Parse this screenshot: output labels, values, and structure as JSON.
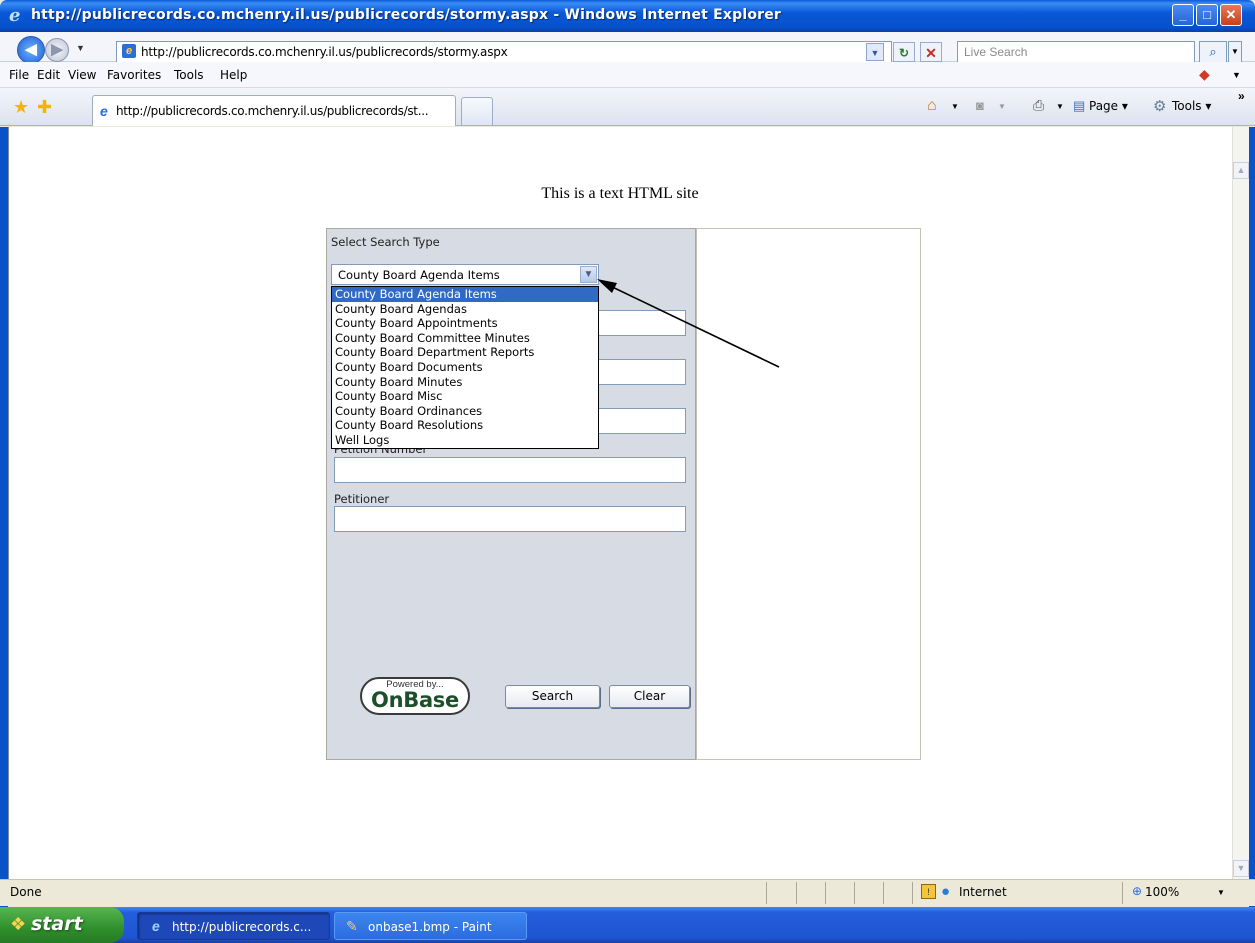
{
  "window": {
    "title": "http://publicrecords.co.mchenry.il.us/publicrecords/stormy.aspx - Windows Internet Explorer",
    "minimize": "_",
    "maximize": "□",
    "close": "✕"
  },
  "address_bar": {
    "url": "http://publicrecords.co.mchenry.il.us/publicrecords/stormy.aspx",
    "search_placeholder": "Live Search"
  },
  "menu": [
    "File",
    "Edit",
    "View",
    "Favorites",
    "Tools",
    "Help"
  ],
  "tab": {
    "title": "http://publicrecords.co.mchenry.il.us/publicrecords/st..."
  },
  "command_bar": {
    "page": "Page ▾",
    "tools": "Tools ▾"
  },
  "page": {
    "heading": "This is a text HTML site",
    "search_panel": {
      "select_label": "Select Search Type",
      "selected_value": "County Board Agenda Items",
      "options": [
        "County Board Agenda Items",
        "County Board Agendas",
        "County Board Appointments",
        "County Board Committee Minutes",
        "County Board Department Reports",
        "County Board Documents",
        "County Board Minutes",
        "County Board Misc",
        "County Board Ordinances",
        "County Board Resolutions",
        "Well Logs"
      ],
      "petition_number_label": "Petition Number",
      "petitioner_label": "Petitioner",
      "powered_by": "Powered by...",
      "brand": "OnBase",
      "search_button": "Search",
      "clear_button": "Clear"
    }
  },
  "status_bar": {
    "status": "Done",
    "zone": "Internet",
    "zoom": "100%"
  },
  "taskbar": {
    "start": "start",
    "tasks": [
      {
        "label": "http://publicrecords.c...",
        "icon": "ie-icon"
      },
      {
        "label": "onbase1.bmp - Paint",
        "icon": "paint-icon"
      }
    ]
  },
  "colors": {
    "titlebar": "#0651cc",
    "selection": "#316ac5",
    "panel": "#d6dbe4",
    "start_button": "#2f8f2c"
  }
}
